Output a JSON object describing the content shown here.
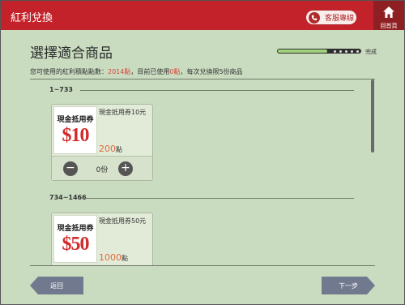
{
  "header": {
    "title": "紅利兌換",
    "service_label": "客服專線",
    "home_label": "回首頁",
    "colors": {
      "brand_red": "#c3222a",
      "home_dark": "#8e1f23"
    }
  },
  "page": {
    "title": "選擇適合商品",
    "progress_label": "完成",
    "progress_fraction": 0.6
  },
  "info": {
    "prefix": "您可使用的紅利積點點數：",
    "available_points": "2014點",
    "mid": "，目前已使用",
    "used_points": "0點",
    "suffix": "，每次兌換限5份商品"
  },
  "sections": [
    {
      "range": "1~733",
      "item": {
        "thumb_label": "現金抵用券",
        "thumb_value": "$10",
        "name": "現金抵用券10元",
        "points": "200",
        "points_unit": "點",
        "quantity": "0份",
        "minus": "−",
        "plus": "+"
      }
    },
    {
      "range": "734~1466",
      "item": {
        "thumb_label": "現金抵用券",
        "thumb_value": "$50",
        "name": "現金抵用券50元",
        "points": "1000",
        "points_unit": "點"
      }
    }
  ],
  "footer": {
    "back_label": "返回",
    "next_label": "下一步"
  }
}
